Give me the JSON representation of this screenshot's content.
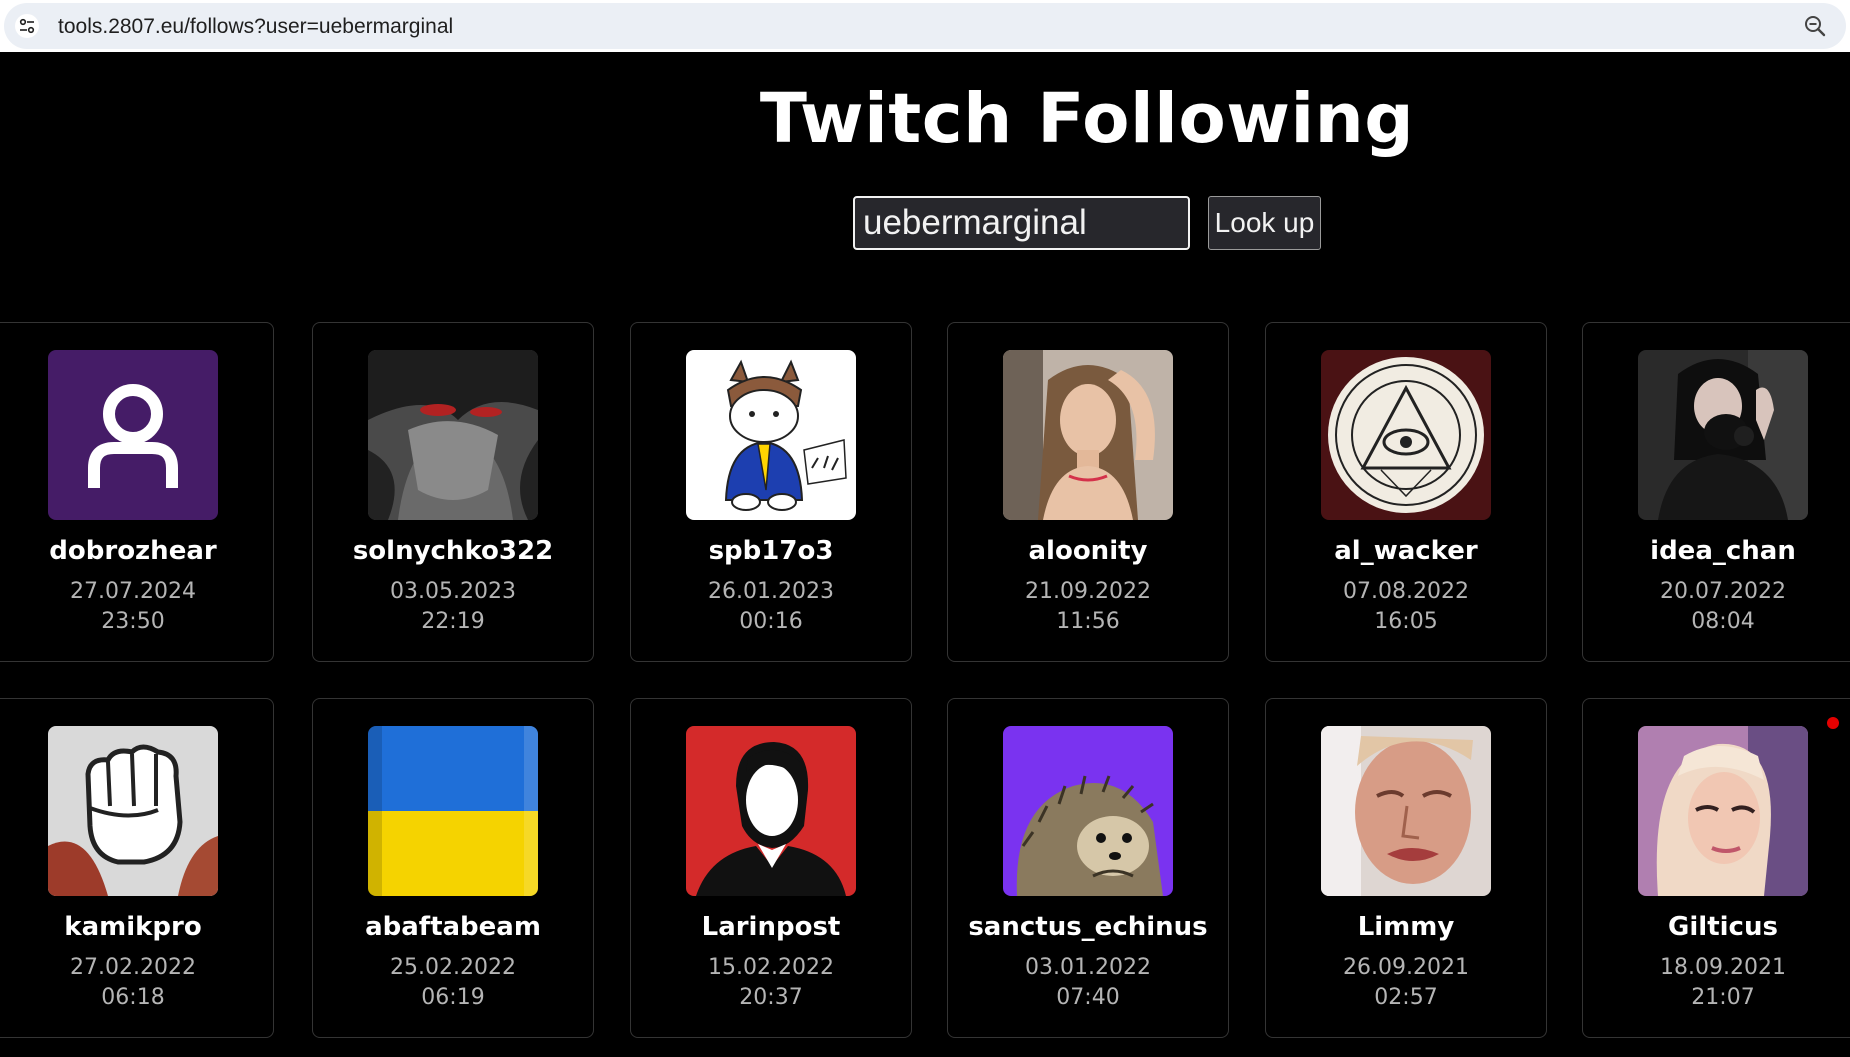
{
  "browser": {
    "url": "tools.2807.eu/follows?user=uebermarginal"
  },
  "page": {
    "title": "Twitch Following",
    "search_value": "uebermarginal",
    "lookup_label": "Look up"
  },
  "follows": [
    {
      "name": "dobrozhear",
      "date": "27.07.2024",
      "time": "23:50",
      "avatar": "default-user-icon"
    },
    {
      "name": "solnychko322",
      "date": "03.05.2023",
      "time": "22:19",
      "avatar": "dark-anime-face"
    },
    {
      "name": "spb17o3",
      "date": "26.01.2023",
      "time": "00:16",
      "avatar": "cartoon-cat"
    },
    {
      "name": "aloonity",
      "date": "21.09.2022",
      "time": "11:56",
      "avatar": "girl-photo"
    },
    {
      "name": "al_wacker",
      "date": "07.08.2022",
      "time": "16:05",
      "avatar": "eye-pyramid-seal"
    },
    {
      "name": "idea_chan",
      "date": "20.07.2022",
      "time": "08:04",
      "avatar": "gas-mask-photo"
    },
    {
      "name": "kamikpro",
      "date": "27.02.2022",
      "time": "06:18",
      "avatar": "fist-icon"
    },
    {
      "name": "abaftabeam",
      "date": "25.02.2022",
      "time": "06:19",
      "avatar": "ukraine-flag"
    },
    {
      "name": "Larinpost",
      "date": "15.02.2022",
      "time": "20:37",
      "avatar": "silhouette-red"
    },
    {
      "name": "sanctus_echinus",
      "date": "03.01.2022",
      "time": "07:40",
      "avatar": "hedgehog"
    },
    {
      "name": "Limmy",
      "date": "26.09.2021",
      "time": "02:57",
      "avatar": "face-photo"
    },
    {
      "name": "Gilticus",
      "date": "18.09.2021",
      "time": "21:07",
      "avatar": "blonde-girl-photo"
    }
  ],
  "colors": {
    "background": "#000000",
    "card_border": "#343434",
    "date_text": "#b5b5b5",
    "default_avatar": "#451c67",
    "indicator": "#e40000"
  }
}
